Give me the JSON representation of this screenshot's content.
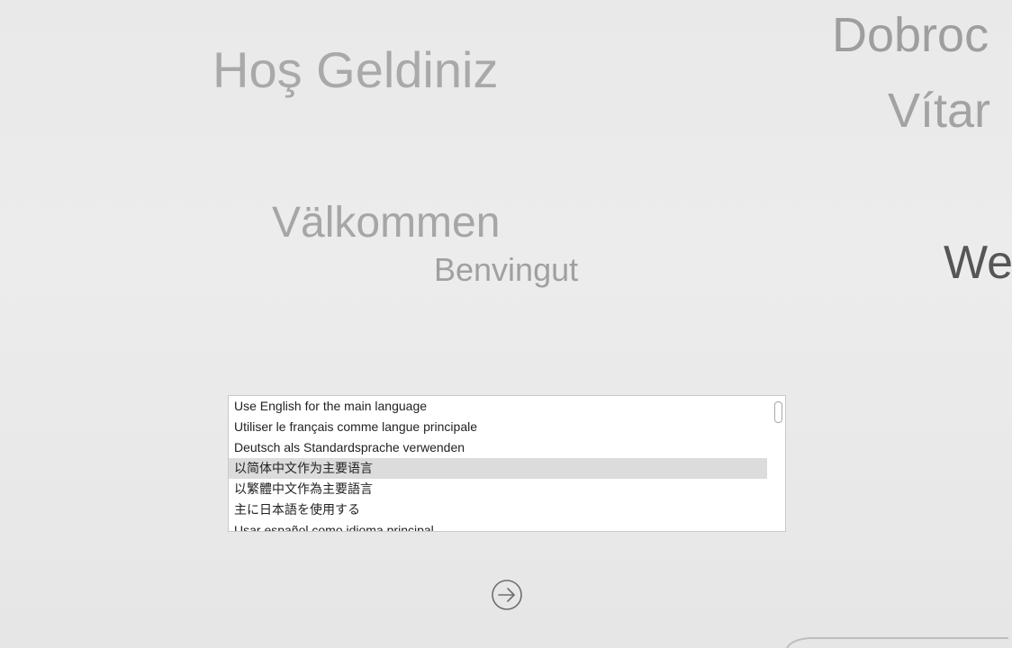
{
  "greetings": [
    {
      "text": "Hoş Geldiniz"
    },
    {
      "text": "Dobroc"
    },
    {
      "text": "Vítar"
    },
    {
      "text": "Välkommen"
    },
    {
      "text": "Benvingut"
    },
    {
      "text": "We"
    }
  ],
  "language_list": {
    "items": [
      "Use English for the main language",
      "Utiliser le français comme langue principale",
      "Deutsch als Standardsprache verwenden",
      "以简体中文作为主要语言",
      "以繁體中文作為主要語言",
      "主に日本語を使用する",
      "Usar español como idioma principal"
    ],
    "selected_index": 3
  },
  "icons": {
    "continue": "arrow-right-circle-icon"
  }
}
